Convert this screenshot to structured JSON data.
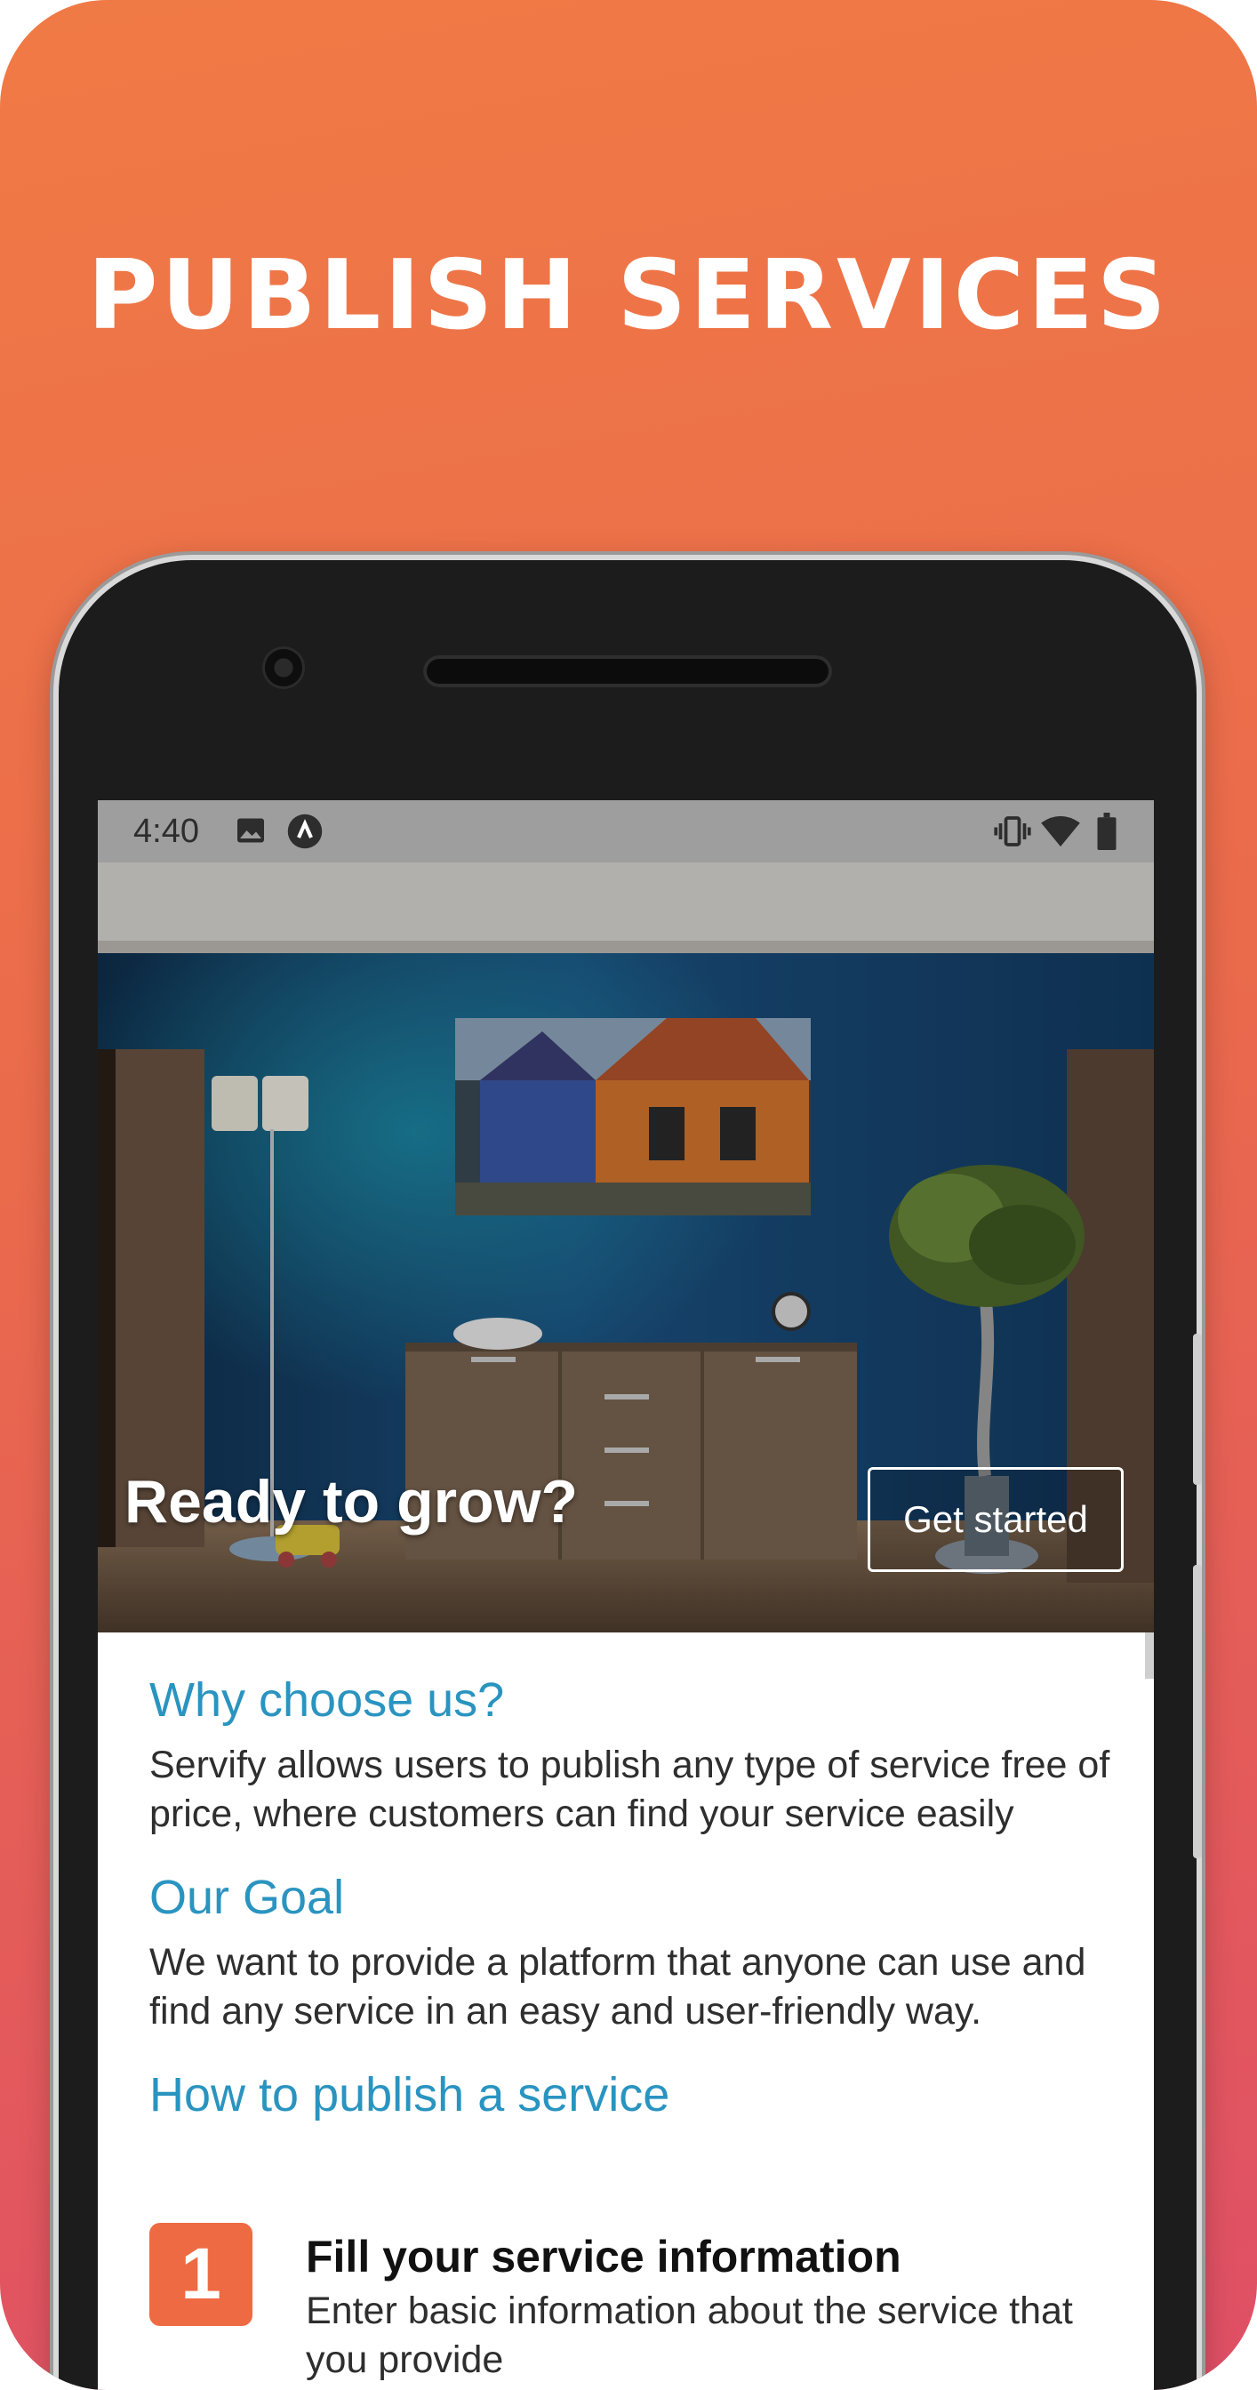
{
  "headline": "PUBLISH SERVICES",
  "status_bar": {
    "time": "4:40",
    "icons": [
      "image-icon",
      "app-notification-icon",
      "vibrate-icon",
      "wifi-icon",
      "battery-icon"
    ]
  },
  "hero": {
    "title": "Ready to grow?",
    "button": "Get started"
  },
  "sections": [
    {
      "title": "Why choose us?",
      "text": "Servify allows users to publish any type of service free of price, where customers can find your service easily"
    },
    {
      "title": "Our Goal",
      "text": "We want to provide a platform that anyone can use and find any service in an easy and user-friendly way."
    },
    {
      "title": "How to publish a service"
    }
  ],
  "steps": [
    {
      "number": "1",
      "title": "Fill your service information",
      "text": "Enter basic information about the service that you provide"
    }
  ],
  "colors": {
    "gradient_top": "#f07a45",
    "gradient_bottom": "#df4f66",
    "section_title": "#2a94c0",
    "step_badge": "#ee6a43",
    "status_bar": "#9e9e9e"
  }
}
